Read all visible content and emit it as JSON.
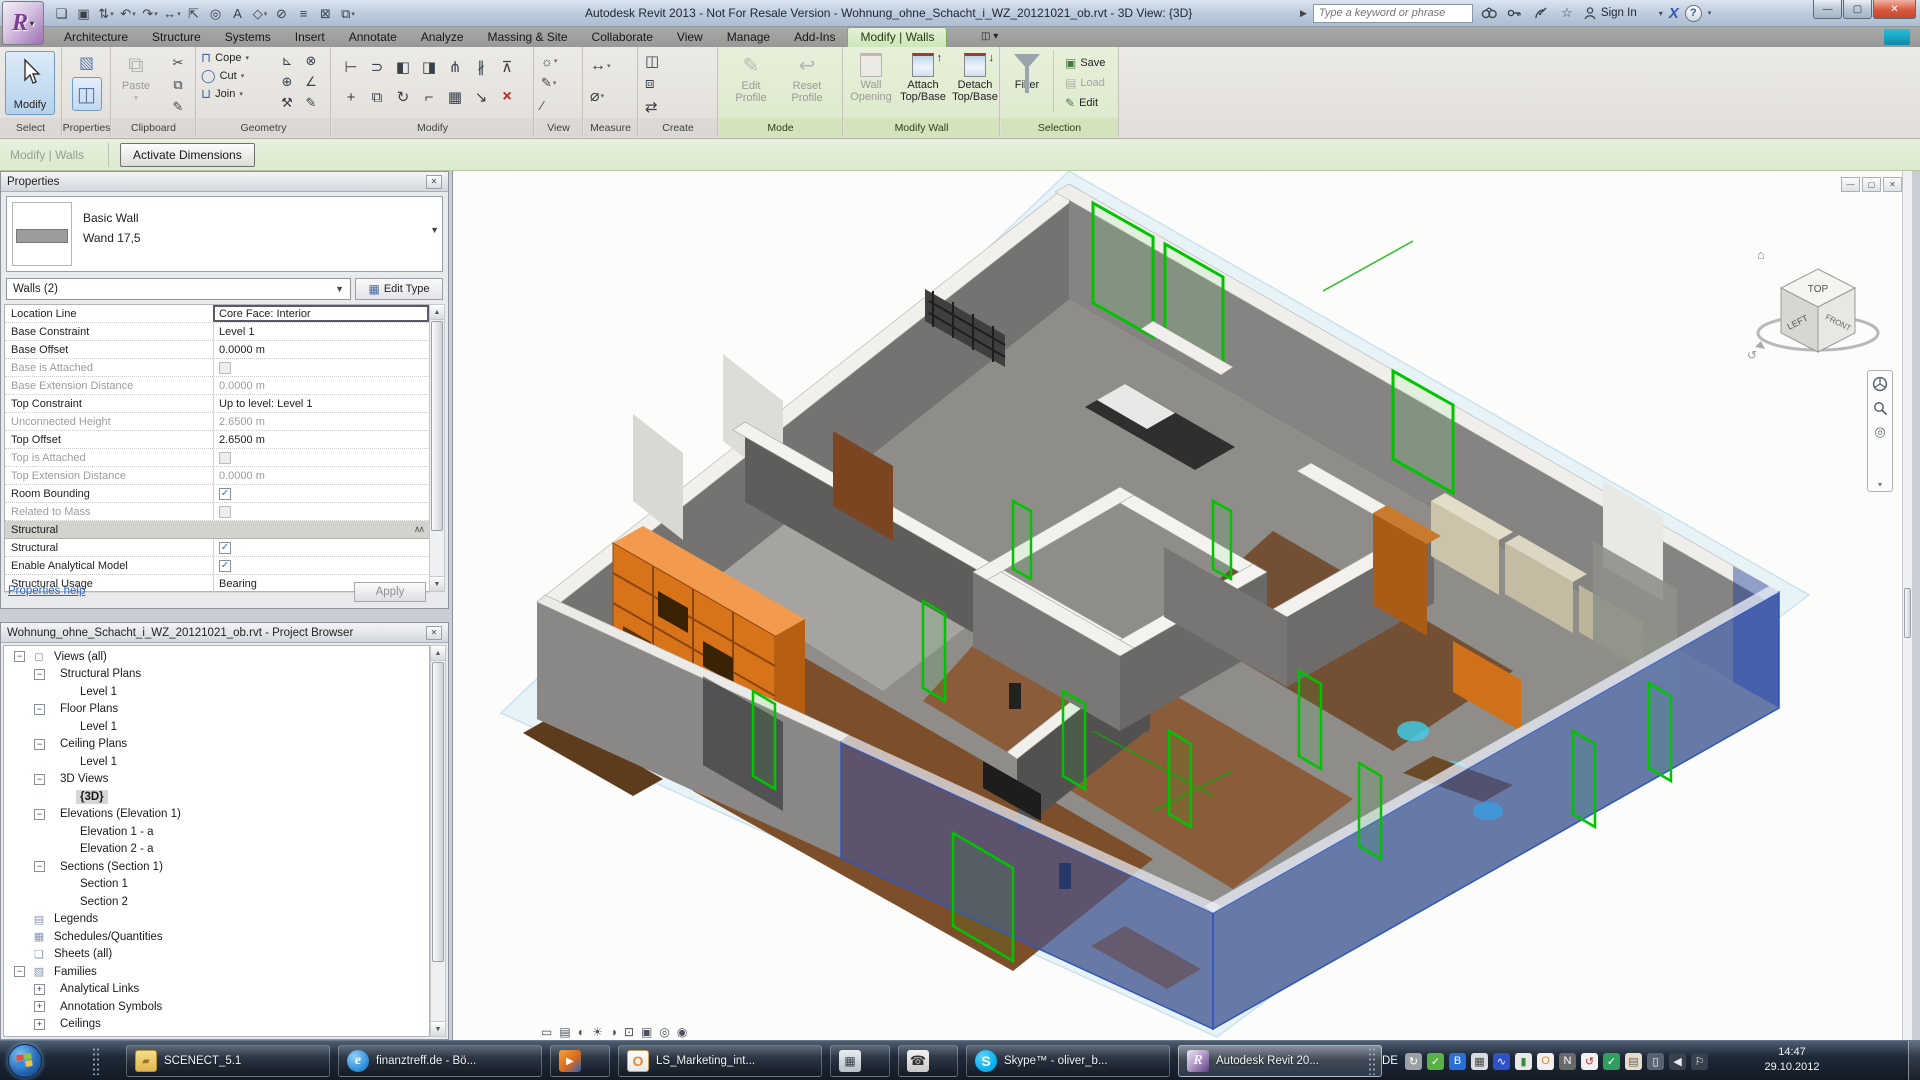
{
  "title_bar": {
    "title": "Autodesk Revit 2013 - Not For Resale Version -   Wohnung_ohne_Schacht_i_WZ_20121021_ob.rvt - 3D View: {3D}",
    "search_placeholder": "Type a keyword or phrase",
    "sign_in": "Sign In",
    "qat": [
      {
        "name": "open-icon",
        "glyph": "❏"
      },
      {
        "name": "save-icon",
        "glyph": "▣"
      },
      {
        "name": "sync-with-central-icon",
        "glyph": "⇅",
        "arrow": "▾"
      },
      {
        "name": "undo-icon",
        "glyph": "↶",
        "arrow": "▾"
      },
      {
        "name": "redo-icon",
        "glyph": "↷",
        "arrow": "▾"
      },
      {
        "name": "aligned-dimension-icon",
        "glyph": "↔",
        "arrow": "▾"
      },
      {
        "name": "measure-icon",
        "glyph": "⇱"
      },
      {
        "name": "tag-icon",
        "glyph": "◎"
      },
      {
        "name": "text-icon",
        "glyph": "A"
      },
      {
        "name": "default-3d-view-icon",
        "glyph": "◇",
        "arrow": "▾"
      },
      {
        "name": "section-icon",
        "glyph": "⊘"
      },
      {
        "name": "thin-lines-icon",
        "glyph": "≡"
      },
      {
        "name": "close-hidden-windows-icon",
        "glyph": "⊠"
      },
      {
        "name": "switch-windows-icon",
        "glyph": "⧉",
        "arrow": "▾"
      }
    ]
  },
  "tabs": [
    {
      "label": "Architecture"
    },
    {
      "label": "Structure"
    },
    {
      "label": "Systems"
    },
    {
      "label": "Insert"
    },
    {
      "label": "Annotate"
    },
    {
      "label": "Analyze"
    },
    {
      "label": "Massing & Site"
    },
    {
      "label": "Collaborate"
    },
    {
      "label": "View"
    },
    {
      "label": "Manage"
    },
    {
      "label": "Add-Ins"
    },
    {
      "label": "Modify | Walls",
      "active": true
    }
  ],
  "ribbon": {
    "select": {
      "modify": "Modify",
      "panel": "Select"
    },
    "properties": {
      "panel": "Properties"
    },
    "clipboard": {
      "paste": "Paste",
      "panel": "Clipboard",
      "side": [
        {
          "name": "cut-icon",
          "glyph": "✂"
        },
        {
          "name": "copy-icon",
          "glyph": "⧉"
        },
        {
          "name": "match-type-icon",
          "glyph": "✎"
        }
      ]
    },
    "geometry": {
      "cope": "Cope",
      "cut": "Cut",
      "join": "Join",
      "panel": "Geometry",
      "side": [
        {
          "name": "wall-joins-icon",
          "glyph": "⊾"
        },
        {
          "name": "cut-profile-icon",
          "glyph": "⊗"
        },
        {
          "name": "apply-coping-icon",
          "glyph": "⊕"
        },
        {
          "name": "angle-joins-icon",
          "glyph": "∠"
        },
        {
          "name": "demolish-icon",
          "glyph": "⚒"
        },
        {
          "name": "paint-icon",
          "glyph": "✎"
        }
      ]
    },
    "modify_panel": {
      "panel": "Modify",
      "icons": [
        {
          "name": "align-icon",
          "glyph": "⊢"
        },
        {
          "name": "offset-icon",
          "glyph": "⊃"
        },
        {
          "name": "mirror-pick-axis-icon",
          "glyph": "◧"
        },
        {
          "name": "mirror-draw-axis-icon",
          "glyph": "◨"
        },
        {
          "name": "split-element-icon",
          "glyph": "⋔"
        },
        {
          "name": "split-with-gap-icon",
          "glyph": "∦"
        },
        {
          "name": "pin-icon",
          "glyph": "⊼"
        },
        {
          "name": "move-icon",
          "glyph": "+"
        },
        {
          "name": "copy-element-icon",
          "glyph": "⧉"
        },
        {
          "name": "rotate-icon",
          "glyph": "↻"
        },
        {
          "name": "trim-extend-icon",
          "glyph": "⌐"
        },
        {
          "name": "array-icon",
          "glyph": "▦"
        },
        {
          "name": "scale-icon",
          "glyph": "↘"
        },
        {
          "name": "delete-icon",
          "glyph": "×",
          "red": true
        }
      ]
    },
    "view_panel": {
      "panel": "View",
      "icons": [
        {
          "name": "reveal-hidden-icon",
          "glyph": "☼",
          "arrow": "▾"
        },
        {
          "name": "override-graphics-icon",
          "glyph": "✎",
          "arrow": "▾"
        },
        {
          "name": "linework-icon",
          "glyph": "∕"
        }
      ]
    },
    "measure": {
      "panel": "Measure",
      "icons": [
        {
          "name": "measure-between-icon",
          "glyph": "↔",
          "arrow": "▾"
        },
        {
          "name": "dimension-icon",
          "glyph": "⌀",
          "arrow": "▾"
        }
      ]
    },
    "create": {
      "panel": "Create",
      "icons": [
        {
          "name": "create-similar-icon",
          "glyph": "◫"
        },
        {
          "name": "create-group-icon",
          "glyph": "⧈"
        },
        {
          "name": "create-assembly-icon",
          "glyph": "⇄"
        }
      ]
    },
    "mode": {
      "edit_profile": "Edit Profile",
      "reset_profile": "Reset Profile",
      "panel": "Mode"
    },
    "modify_wall": {
      "wall_opening": "Wall Opening",
      "attach": "Attach Top/Base",
      "detach": "Detach Top/Base",
      "panel": "Modify Wall"
    },
    "selection": {
      "filter": "Filter",
      "save": "Save",
      "load": "Load",
      "edit": "Edit",
      "panel": "Selection"
    }
  },
  "options_bar": {
    "mode_label": "Modify | Walls",
    "activate_dimensions": "Activate Dimensions"
  },
  "properties": {
    "header": "Properties",
    "type_name": "Basic Wall",
    "type_sub": "Wand 17,5",
    "selector": "Walls (2)",
    "edit_type": "Edit Type",
    "rows": [
      {
        "label": "Location Line",
        "value": "Core Face: Interior",
        "selected": true
      },
      {
        "label": "Base Constraint",
        "value": "Level 1"
      },
      {
        "label": "Base Offset",
        "value": "0.0000 m"
      },
      {
        "label": "Base is Attached",
        "check": true,
        "disabled": true
      },
      {
        "label": "Base Extension Distance",
        "value": "0.0000 m",
        "disabled": true
      },
      {
        "label": "Top Constraint",
        "value": "Up to level: Level 1"
      },
      {
        "label": "Unconnected Height",
        "value": "2.6500 m",
        "disabled": true
      },
      {
        "label": "Top Offset",
        "value": "2.6500 m"
      },
      {
        "label": "Top is Attached",
        "check": true,
        "disabled": true
      },
      {
        "label": "Top Extension Distance",
        "value": "0.0000 m",
        "disabled": true
      },
      {
        "label": "Room Bounding",
        "check": true,
        "checked": true
      },
      {
        "label": "Related to Mass",
        "check": true,
        "disabled": true
      },
      {
        "label": "Structural",
        "group": true
      },
      {
        "label": "Structural",
        "check": true,
        "checked": true
      },
      {
        "label": "Enable Analytical Model",
        "check": true,
        "checked": true
      },
      {
        "label": "Structural Usage",
        "value": "Bearing"
      }
    ],
    "help_link": "Properties help",
    "apply": "Apply"
  },
  "browser": {
    "header": "Wohnung_ohne_Schacht_i_WZ_20121021_ob.rvt - Project Browser",
    "items": [
      {
        "label": "Views (all)",
        "depth": 0,
        "expand": "minus",
        "icon": "views"
      },
      {
        "label": "Structural Plans",
        "depth": 1,
        "expand": "minus"
      },
      {
        "label": "Level 1",
        "depth": 2
      },
      {
        "label": "Floor Plans",
        "depth": 1,
        "expand": "minus"
      },
      {
        "label": "Level 1",
        "depth": 2
      },
      {
        "label": "Ceiling Plans",
        "depth": 1,
        "expand": "minus"
      },
      {
        "label": "Level 1",
        "depth": 2
      },
      {
        "label": "3D Views",
        "depth": 1,
        "expand": "minus"
      },
      {
        "label": "{3D}",
        "depth": 2,
        "selected": true,
        "bold": true
      },
      {
        "label": "Elevations (Elevation 1)",
        "depth": 1,
        "expand": "minus"
      },
      {
        "label": "Elevation 1 - a",
        "depth": 2
      },
      {
        "label": "Elevation 2 - a",
        "depth": 2
      },
      {
        "label": "Sections (Section 1)",
        "depth": 1,
        "expand": "minus"
      },
      {
        "label": "Section 1",
        "depth": 2
      },
      {
        "label": "Section 2",
        "depth": 2
      },
      {
        "label": "Legends",
        "depth": 0,
        "icon": "legends"
      },
      {
        "label": "Schedules/Quantities",
        "depth": 0,
        "icon": "schedules"
      },
      {
        "label": "Sheets (all)",
        "depth": 0,
        "icon": "sheets"
      },
      {
        "label": "Families",
        "depth": 0,
        "expand": "minus",
        "icon": "families"
      },
      {
        "label": "Analytical Links",
        "depth": 1,
        "expand": "plus"
      },
      {
        "label": "Annotation Symbols",
        "depth": 1,
        "expand": "plus"
      },
      {
        "label": "Ceilings",
        "depth": 1,
        "expand": "plus"
      }
    ]
  },
  "viewcube": {
    "top": "TOP",
    "left": "LEFT",
    "front": "FRONT"
  },
  "view_control": [
    {
      "name": "scale-icon",
      "glyph": "▭"
    },
    {
      "name": "detail-level-icon",
      "glyph": "▤"
    },
    {
      "name": "visual-style-icon",
      "glyph": "◐"
    },
    {
      "name": "sun-path-icon",
      "glyph": "☀"
    },
    {
      "name": "shadows-icon",
      "glyph": "◑"
    },
    {
      "name": "crop-view-icon",
      "glyph": "⊡"
    },
    {
      "name": "show-crop-icon",
      "glyph": "▣"
    },
    {
      "name": "temporary-hide-icon",
      "glyph": "◎"
    },
    {
      "name": "reveal-hidden-elements-icon",
      "glyph": "◉"
    }
  ],
  "taskbar": {
    "items": [
      {
        "name": "taskbar-item-scenect",
        "label": "SCENECT_5.1",
        "icon": "folder"
      },
      {
        "name": "taskbar-item-ie",
        "label": "finanztreff.de - Bö...",
        "icon": "ie"
      },
      {
        "name": "taskbar-item-media-player",
        "label": "",
        "icon": "wmp",
        "icononly": true
      },
      {
        "name": "taskbar-item-outlook",
        "label": "LS_Marketing_int...",
        "icon": "outlook"
      },
      {
        "name": "taskbar-item-calculator",
        "label": "",
        "icon": "calc",
        "icononly": true
      },
      {
        "name": "taskbar-item-phone",
        "label": "",
        "icon": "phone",
        "icononly": true
      },
      {
        "name": "taskbar-item-skype",
        "label": "Skype™ - oliver_b...",
        "icon": "skype"
      },
      {
        "name": "taskbar-item-revit",
        "label": "Autodesk Revit 20...",
        "icon": "revit",
        "active": true
      }
    ],
    "language": "DE",
    "tray": [
      {
        "name": "update-tray-icon",
        "glyph": "↻",
        "bg": "#9aa0a6",
        "fg": "#ffffff"
      },
      {
        "name": "security-shield-icon",
        "glyph": "✓",
        "bg": "#58b246",
        "fg": "#ffffff"
      },
      {
        "name": "bluetooth-icon",
        "glyph": "B",
        "bg": "#2a6fd6",
        "fg": "#ffffff"
      },
      {
        "name": "calculator-tray-icon",
        "glyph": "▦",
        "bg": "#d8dce0",
        "fg": "#444444"
      },
      {
        "name": "audio-manager-icon",
        "glyph": "∿",
        "bg": "#3050c8",
        "fg": "#ffffff"
      },
      {
        "name": "battery-icon",
        "glyph": "▮",
        "bg": "#e8e8e8",
        "fg": "#3a8a3a"
      },
      {
        "name": "outlook-tray-icon",
        "glyph": "O",
        "bg": "#f0f0f0",
        "fg": "#e8882d"
      },
      {
        "name": "onenote-icon",
        "glyph": "N",
        "bg": "#6a6a6a",
        "fg": "#ffffff"
      },
      {
        "name": "sync-tray-icon",
        "glyph": "↺",
        "bg": "#f0f0f0",
        "fg": "#c03030"
      },
      {
        "name": "antivirus-icon",
        "glyph": "✓",
        "bg": "#2f9e60",
        "fg": "#ffffff"
      },
      {
        "name": "clipboard-tray-icon",
        "glyph": "▤",
        "bg": "#e8dcc8",
        "fg": "#666666"
      },
      {
        "name": "network-icon",
        "glyph": "▯",
        "bg": "#5a6470",
        "fg": "#ffffff"
      },
      {
        "name": "volume-icon",
        "glyph": "◀",
        "bg": "#38404c",
        "fg": "#e8ecf0"
      },
      {
        "name": "action-center-flag-icon",
        "glyph": "⚐",
        "bg": "#38404c",
        "fg": "#f5f5f5"
      }
    ],
    "time": "14:47",
    "date": "29.10.2012"
  }
}
